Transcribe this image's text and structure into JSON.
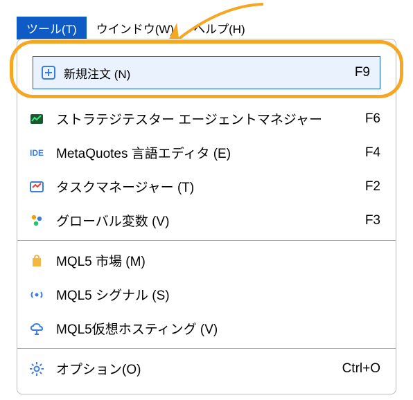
{
  "menubar": {
    "tools": "ツール(T)",
    "window": "ウインドウ(W)",
    "help": "ヘルプ(H)"
  },
  "menu": {
    "new_order": {
      "label": "新規注文 (N)",
      "shortcut": "F9"
    },
    "strategy_tester": {
      "label": "ストラテジテスター エージェントマネジャー",
      "shortcut": "F6"
    },
    "metaeditor": {
      "label": "MetaQuotes 言語エディタ (E)",
      "shortcut": "F4"
    },
    "task_manager": {
      "label": "タスクマネージャー (T)",
      "shortcut": "F2"
    },
    "global_vars": {
      "label": "グローバル変数 (V)",
      "shortcut": "F3"
    },
    "mql5_market": {
      "label": "MQL5 市場 (M)"
    },
    "mql5_signal": {
      "label": "MQL5 シグナル (S)"
    },
    "mql5_hosting": {
      "label": "MQL5仮想ホスティング (V)"
    },
    "options": {
      "label": "オプション(O)",
      "shortcut": "Ctrl+O"
    }
  },
  "ide_text": "IDE"
}
